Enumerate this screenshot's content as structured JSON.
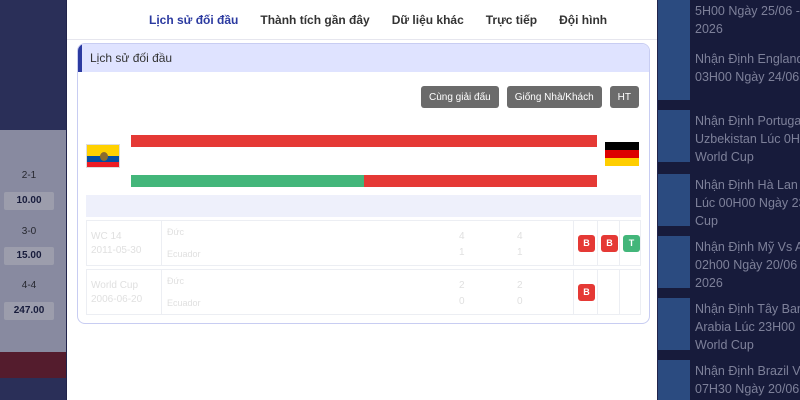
{
  "background": {
    "odds": [
      {
        "score": "2-1",
        "odd": "10.00"
      },
      {
        "score": "3-0",
        "odd": "15.00"
      },
      {
        "score": "4-4",
        "odd": "247.00"
      }
    ],
    "news": [
      "5H00 Ngày 25/06 -\n2026",
      "Nhận Định England\n03H00 Ngày 24/06",
      "Nhận Định Portugal\nUzbekistan Lúc 0H\nWorld Cup",
      "Nhận Định Hà Lan T\nLúc 00H00 Ngày 23\nCup",
      "Nhận Định Mỹ Vs A\n02h00 Ngày 20/06\n2026",
      "Nhận Định Tây Ban\nArabia Lúc 23H00\nWorld Cup",
      "Nhận Định Brazil Vs\n07H30 Ngày 20/06"
    ]
  },
  "tabs": [
    "Lịch sử đối đầu",
    "Thành tích gần đây",
    "Dữ liệu khác",
    "Trực tiếp",
    "Đội hình"
  ],
  "active_tab": 0,
  "panel": {
    "title": "Lịch sử đối đầu",
    "filters": [
      "Cùng giải đấu",
      "Giống Nhà/Khách",
      "HT"
    ],
    "home_flag": "ecuador-flag",
    "away_flag": "germany-flag",
    "bar2_green_fraction": 0.5,
    "colors": {
      "red": "#e53935",
      "green": "#43b67a",
      "accent": "#2b3aa0"
    },
    "rows": [
      {
        "league": "WC 14",
        "date": "2011-05-30",
        "home": "Đức",
        "away": "Ecuador",
        "s1": "4",
        "s2": "1",
        "s3": "4",
        "s4": "1",
        "results": [
          "B",
          "B",
          "T"
        ]
      },
      {
        "league": "World Cup",
        "date": "2006-06-20",
        "home": "Đức",
        "away": "Ecuador",
        "s1": "2",
        "s2": "0",
        "s3": "2",
        "s4": "0",
        "results": [
          "B"
        ]
      }
    ]
  }
}
